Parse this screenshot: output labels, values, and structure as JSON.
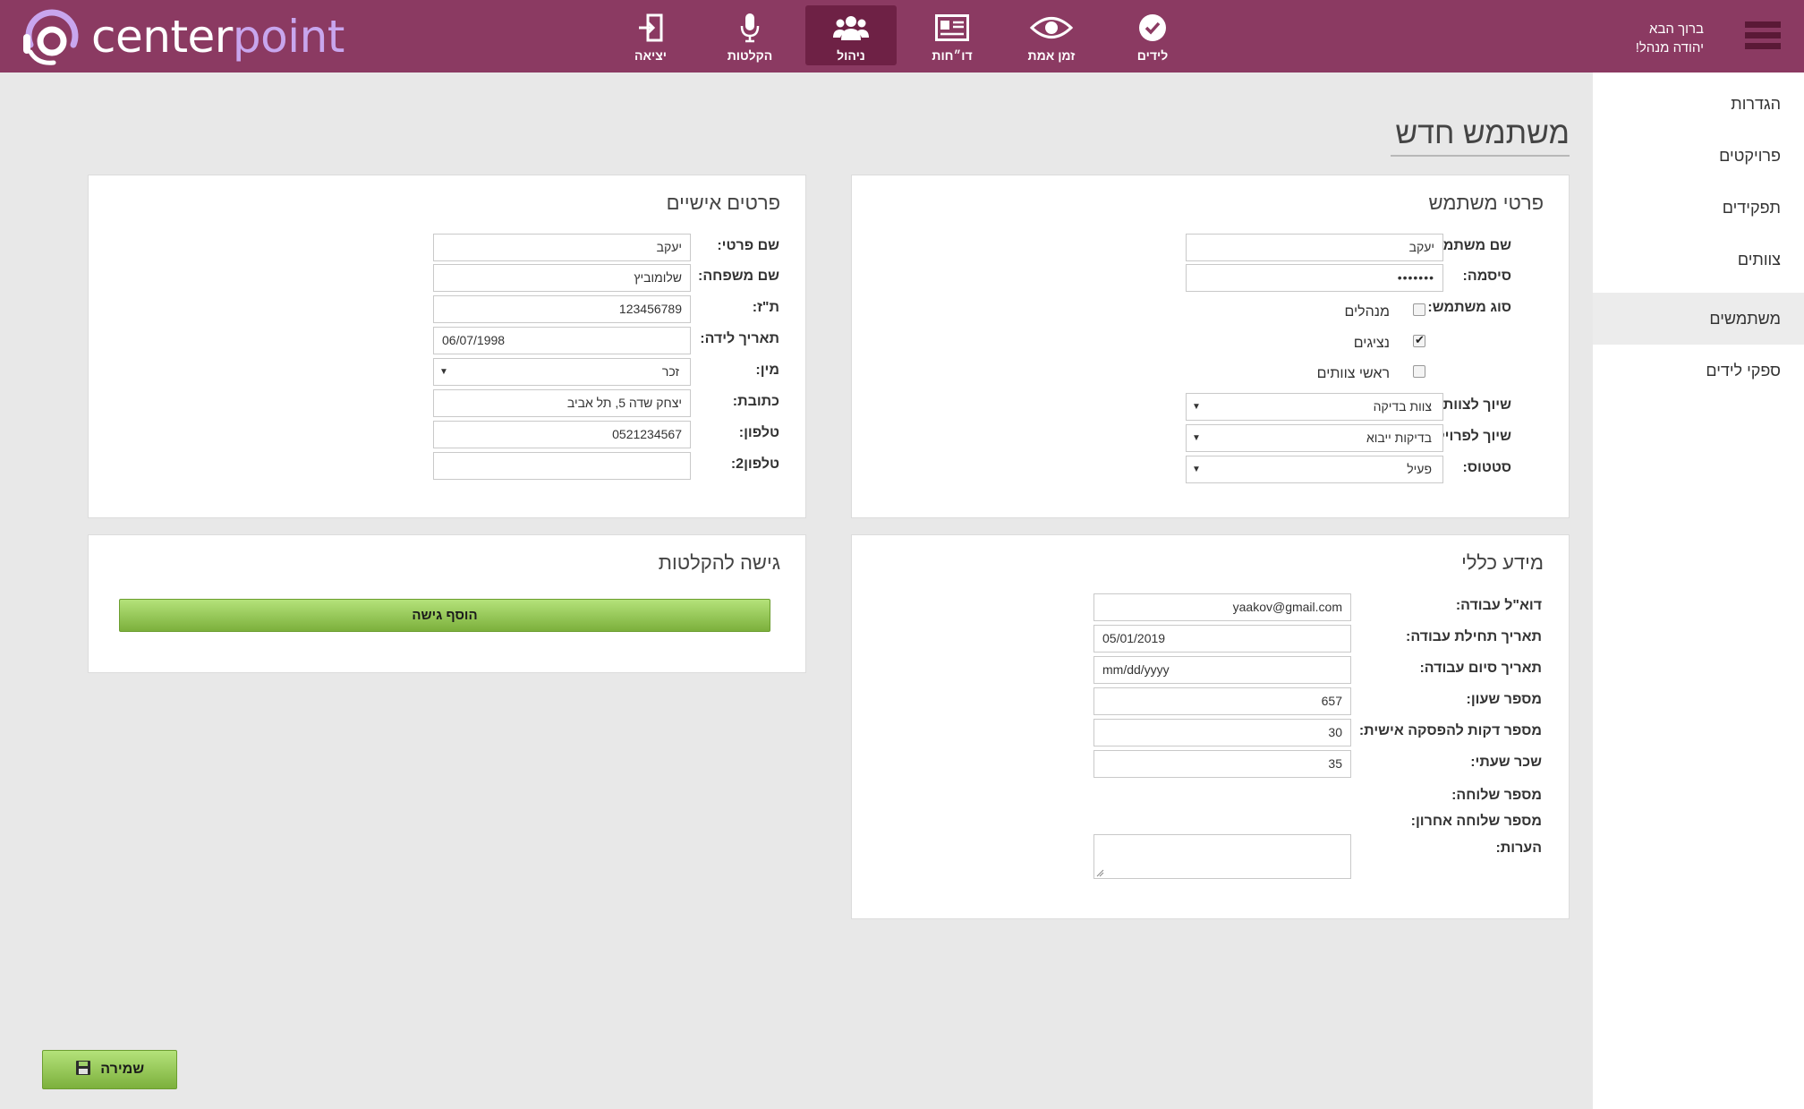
{
  "header": {
    "logo_part1": "center",
    "logo_part2": "point",
    "welcome_line1": "ברוך הבא",
    "welcome_line2": "יהודה מנהל!",
    "nav": [
      {
        "label": "יציאה",
        "icon": "exit-icon"
      },
      {
        "label": "הקלטות",
        "icon": "microphone-icon"
      },
      {
        "label": "ניהול",
        "icon": "users-icon",
        "active": true
      },
      {
        "label": "דו״חות",
        "icon": "report-card-icon"
      },
      {
        "label": "זמן אמת",
        "icon": "eye-icon"
      },
      {
        "label": "לידים",
        "icon": "check-circle-icon"
      }
    ]
  },
  "sidebar": {
    "items": [
      {
        "label": "הגדרות"
      },
      {
        "label": "פרויקטים"
      },
      {
        "label": "תפקידים"
      },
      {
        "label": "צוותים"
      },
      {
        "label": "משתמשים",
        "active": true
      },
      {
        "label": "ספקי לידים"
      }
    ]
  },
  "page_title": "משתמש חדש",
  "user_details": {
    "title": "פרטי משתמש",
    "username_label": "שם משתמש:",
    "username_value": "יעקב",
    "password_label": "סיסמה:",
    "password_value": "•••••••",
    "user_type_label": "סוג משתמש:",
    "type_options": [
      {
        "label": "מנהלים",
        "checked": false
      },
      {
        "label": "נציגים",
        "checked": true
      },
      {
        "label": "ראשי צוותים",
        "checked": false
      }
    ],
    "team_label": "שיוך לצוות:",
    "team_value": "צוות בדיקה",
    "project_label": "שיוך לפרויקט:",
    "project_value": "בדיקות ייבוא",
    "status_label": "סטטוס:",
    "status_value": "פעיל"
  },
  "personal": {
    "title": "פרטים אישיים",
    "first_name_label": "שם פרטי:",
    "first_name_value": "יעקב",
    "last_name_label": "שם משפחה:",
    "last_name_value": "שלומוביץ",
    "id_label": "ת\"ז:",
    "id_value": "123456789",
    "birth_label": "תאריך לידה:",
    "birth_value": "06/07/1998",
    "gender_label": "מין:",
    "gender_value": "זכר",
    "address_label": "כתובת:",
    "address_value": "יצחק שדה 5, תל אביב",
    "phone_label": "טלפון:",
    "phone_value": "0521234567",
    "phone2_label": "טלפון2:",
    "phone2_value": ""
  },
  "general": {
    "title": "מידע כללי",
    "email_label": "דוא\"ל עבודה:",
    "email_value": "yaakov@gmail.com",
    "start_label": "תאריך תחילת עבודה:",
    "start_value": "05/01/2019",
    "end_label": "תאריך סיום עבודה:",
    "end_placeholder": "mm/dd/yyyy",
    "clock_label": "מספר שעון:",
    "clock_value": "657",
    "break_label": "מספר דקות להפסקה אישית:",
    "break_value": "30",
    "wage_label": "שכר שעתי:",
    "wage_value": "35",
    "ext_label": "מספר שלוחה:",
    "last_ext_label": "מספר שלוחה אחרון:",
    "notes_label": "הערות:"
  },
  "recordings": {
    "title": "גישה להקלטות",
    "add_button": "הוסף גישה"
  },
  "save_button": "שמירה",
  "colors": {
    "header": "#8b3a62",
    "nav_active": "#6e2145",
    "button_green": "#8cc152"
  }
}
